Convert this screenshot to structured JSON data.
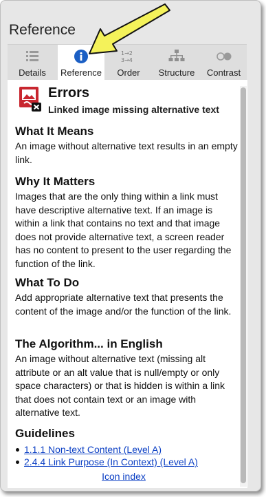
{
  "panel": {
    "title": "Reference"
  },
  "tabs": [
    {
      "label": "Details",
      "icon": "list-icon"
    },
    {
      "label": "Reference",
      "icon": "info-icon",
      "active": true
    },
    {
      "label": "Order",
      "icon": "order-icon"
    },
    {
      "label": "Structure",
      "icon": "structure-icon"
    },
    {
      "label": "Contrast",
      "icon": "contrast-icon"
    }
  ],
  "error": {
    "title": "Errors",
    "subtitle": "Linked image missing alternative text",
    "icon": "linked-image-error-icon"
  },
  "sections": {
    "what_it_means": {
      "heading": "What It Means",
      "text": "An image without alternative text results in an empty link."
    },
    "why_it_matters": {
      "heading": "Why It Matters",
      "text": "Images that are the only thing within a link must have descriptive alternative text. If an image is within a link that contains no text and that image does not provide alternative text, a screen reader has no content to present to the user regarding the function of the link."
    },
    "what_to_do": {
      "heading": "What To Do",
      "text": "Add appropriate alternative text that presents the content of the image and/or the function of the link."
    },
    "algorithm": {
      "heading": "The Algorithm... in English",
      "text": "An image without alternative text (missing alt attribute or an alt value that is null/empty or only space characters) or that is hidden is within a link that does not contain text or an image with alternative text."
    },
    "guidelines": {
      "heading": "Guidelines",
      "items": [
        "1.1.1 Non-text Content (Level A)",
        "2.4.4 Link Purpose (In Context) (Level A)"
      ]
    }
  },
  "footer": {
    "icon_index_link": "Icon index"
  },
  "colors": {
    "accent": "#1b5fc4",
    "arrow": "#f4f25a",
    "error": "#c8262f"
  }
}
